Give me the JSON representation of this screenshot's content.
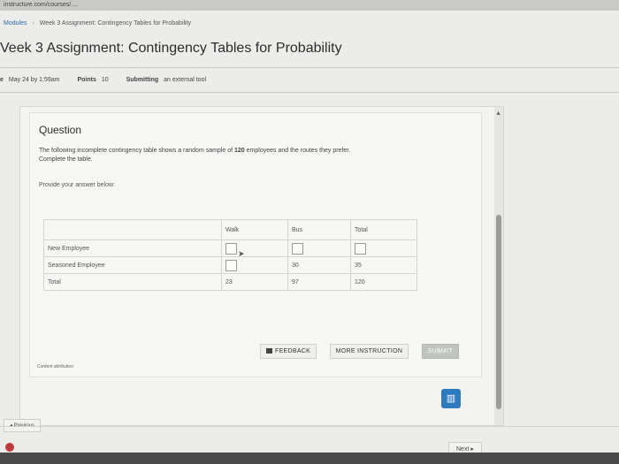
{
  "browser": {
    "url": "instructure.com/courses/...."
  },
  "breadcrumb": {
    "modules": "Modules",
    "separator": "›",
    "current": "Week 3 Assignment: Contingency Tables for Probability"
  },
  "page_title": "Veek 3 Assignment: Contingency Tables for Probability",
  "meta": {
    "due_label": "e",
    "due_value": "May 24 by 1:59am",
    "points_label": "Points",
    "points_value": "10",
    "submitting_label": "Submitting",
    "submitting_value": "an external tool"
  },
  "question": {
    "heading": "Question",
    "text_part1": "The following incomplete contingency table shows a random sample of ",
    "text_bold": "120",
    "text_part2": " employees and the routes they prefer.",
    "text_line2": "Complete the table.",
    "provide": "Provide your answer below:"
  },
  "table": {
    "headers": [
      "",
      "Walk",
      "Bus",
      "Total"
    ],
    "rows": [
      {
        "label": "New Employee",
        "walk": "",
        "bus": "",
        "total": ""
      },
      {
        "label": "Seasoned Employee",
        "walk": "",
        "bus": "30",
        "total": "35"
      },
      {
        "label": "Total",
        "walk": "23",
        "bus": "97",
        "total": "120"
      }
    ]
  },
  "buttons": {
    "feedback": "FEEDBACK",
    "more_instruction": "MORE INSTRUCTION",
    "submit": "SUBMIT"
  },
  "content_attribution": "Content attribution",
  "nav": {
    "previous": "◂ Previous",
    "next": "Next ▸"
  },
  "icons": {
    "chat": "chat-icon",
    "feedback": "feedback-icon",
    "cursor": "cursor-icon"
  },
  "colors": {
    "accent": "#2e7bc0",
    "submit_bg": "#bfc4c0"
  }
}
